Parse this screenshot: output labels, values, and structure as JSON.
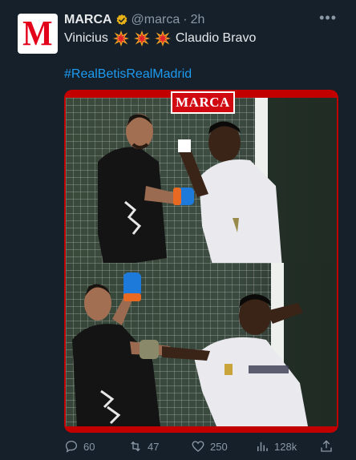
{
  "author": {
    "name": "MARCA",
    "handle": "@marca",
    "separator": "·",
    "time": "2h",
    "avatar_letter": "M",
    "avatar_color": "#e3001b"
  },
  "tweet": {
    "text_before": "Vinicius",
    "emojis": [
      "collision",
      "collision",
      "collision"
    ],
    "text_after": "Claudio Bravo",
    "hashtag": "#RealBetisRealMadrid"
  },
  "media": {
    "watermark": "MARCA",
    "frame_color": "#c20000"
  },
  "actions": {
    "replies": "60",
    "retweets": "47",
    "likes": "250",
    "views": "128k"
  },
  "colors": {
    "background": "#15202b",
    "link": "#1d9bf0",
    "muted": "#8b98a5",
    "verified": "#e8b017"
  }
}
